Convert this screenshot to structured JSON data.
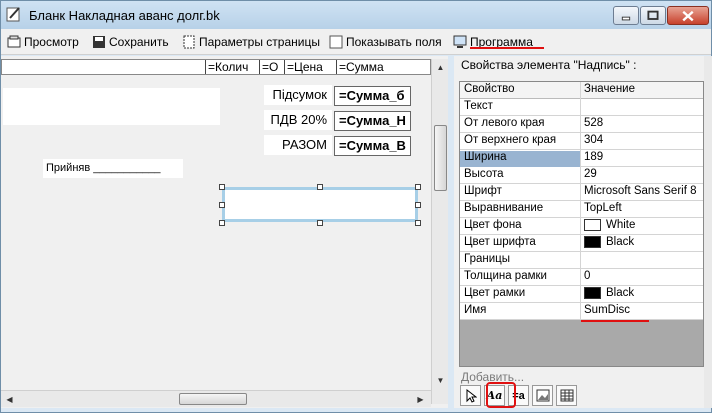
{
  "window": {
    "title": "Бланк  Накладная аванс долг.bk",
    "colors": {
      "accent_red": "#e01010",
      "selection": "#a7cfe7"
    }
  },
  "toolbar": {
    "preview": "Просмотр",
    "save": "Сохранить",
    "page_params": "Параметры страницы",
    "show_fields": "Показывать поля",
    "program": "Программа"
  },
  "designer": {
    "ruler": [
      "=Колич",
      "=О",
      "=Цена",
      "=Сумма"
    ],
    "rows": [
      {
        "label": "Підсумок",
        "value": "=Сумма_б"
      },
      {
        "label": "ПДВ 20%",
        "value": "=Сумма_Н"
      },
      {
        "label": "РАЗОМ",
        "value": "=Сумма_В"
      }
    ],
    "accepted": "Прийняв ___________"
  },
  "properties": {
    "title": "Свойства элемента \"Надпись\" :",
    "header": {
      "name": "Свойство",
      "value": "Значение"
    },
    "rows": [
      {
        "name": "Текст",
        "value": ""
      },
      {
        "name": "От левого края",
        "value": "528"
      },
      {
        "name": "От верхнего края",
        "value": "304"
      },
      {
        "name": "Ширина",
        "value": "189"
      },
      {
        "name": "Высота",
        "value": "29"
      },
      {
        "name": "Шрифт",
        "value": "Microsoft Sans Serif 8"
      },
      {
        "name": "Выравнивание",
        "value": "TopLeft"
      },
      {
        "name": "Цвет фона",
        "value": "White"
      },
      {
        "name": "Цвет шрифта",
        "value": "Black"
      },
      {
        "name": "Границы",
        "value": ""
      },
      {
        "name": "Толщина рамки",
        "value": "0"
      },
      {
        "name": "Цвет рамки",
        "value": "Black"
      },
      {
        "name": "Имя",
        "value": "SumDisc"
      }
    ],
    "add": "Добавить...",
    "tools": [
      "pointer-icon",
      "text-label-icon",
      "field-icon",
      "image-icon",
      "table-icon"
    ],
    "tool_text": {
      "text": "Aa",
      "field": "=a"
    }
  }
}
